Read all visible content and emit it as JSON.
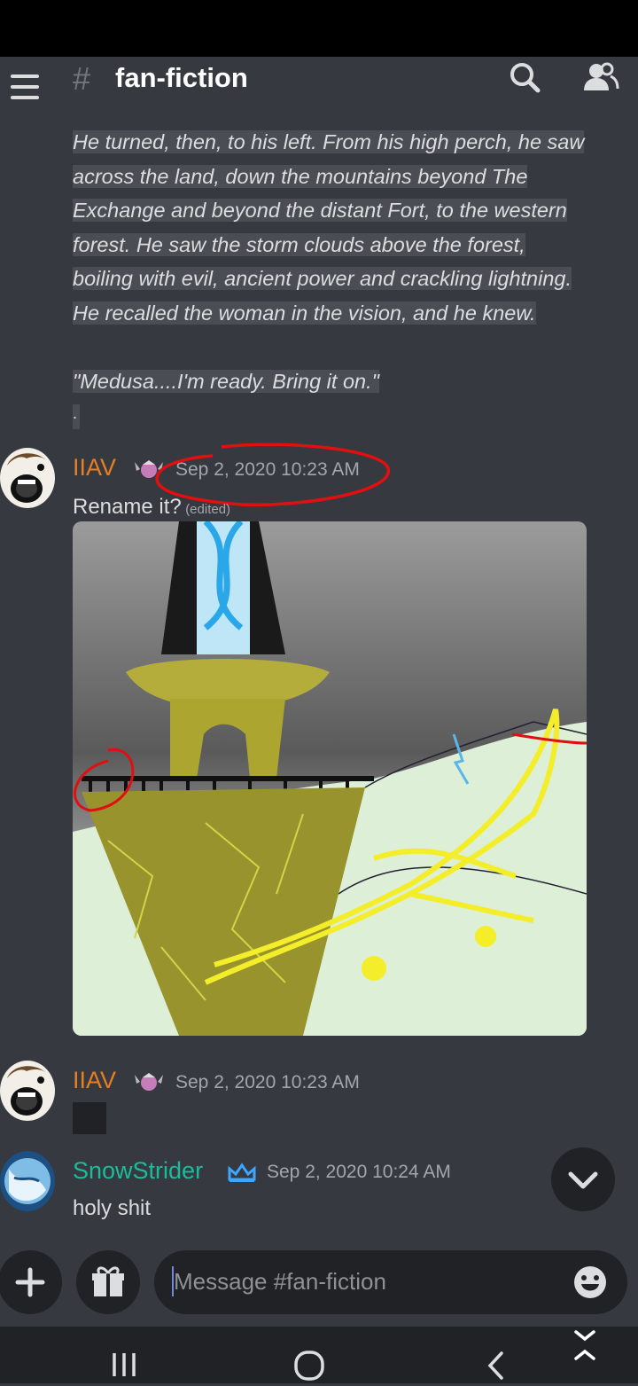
{
  "channel": {
    "hash_symbol": "#",
    "name": "fan-fiction"
  },
  "messages": {
    "continuation": {
      "paragraph": [
        "He turned, then, to his left. From his high perch, he saw",
        "across the land, down the mountains beyond The",
        "Exchange and beyond the distant Fort, to the western",
        "forest. He saw the storm clouds above the forest,",
        "boiling with evil, ancient power and crackling lightning.",
        "He recalled the woman in the vision, and he knew."
      ],
      "closing_line": "\"Medusa....I'm ready. Bring it on.\"",
      "trailing_dot": "."
    },
    "m1": {
      "author": "IIAV",
      "author_color": "#e67e22",
      "timestamp": "Sep 2, 2020 10:23 AM",
      "text": "Rename it?",
      "edited": "(edited)"
    },
    "m2": {
      "author": "IIAV",
      "author_color": "#e67e22",
      "timestamp": "Sep 2, 2020 10:23 AM"
    },
    "m3": {
      "author": "SnowStrider",
      "author_color": "#1abc9c",
      "timestamp": "Sep 2, 2020 10:24 AM",
      "text": "holy shit"
    }
  },
  "composer": {
    "placeholder": "Message #fan-fiction"
  },
  "icons": {
    "menu": "hamburger-menu-icon",
    "search": "search-icon",
    "members": "members-icon",
    "add": "plus-icon",
    "gift": "gift-icon",
    "emoji": "emoji-icon",
    "scroll": "chevron-down-icon",
    "nav_recent": "recent-apps-icon",
    "nav_home": "home-icon",
    "nav_back": "back-icon",
    "keyboard_toggle": "keyboard-toggle-icon"
  },
  "colors": {
    "background": "#36393f",
    "dark": "#202225",
    "annotation_red": "#e01010"
  }
}
